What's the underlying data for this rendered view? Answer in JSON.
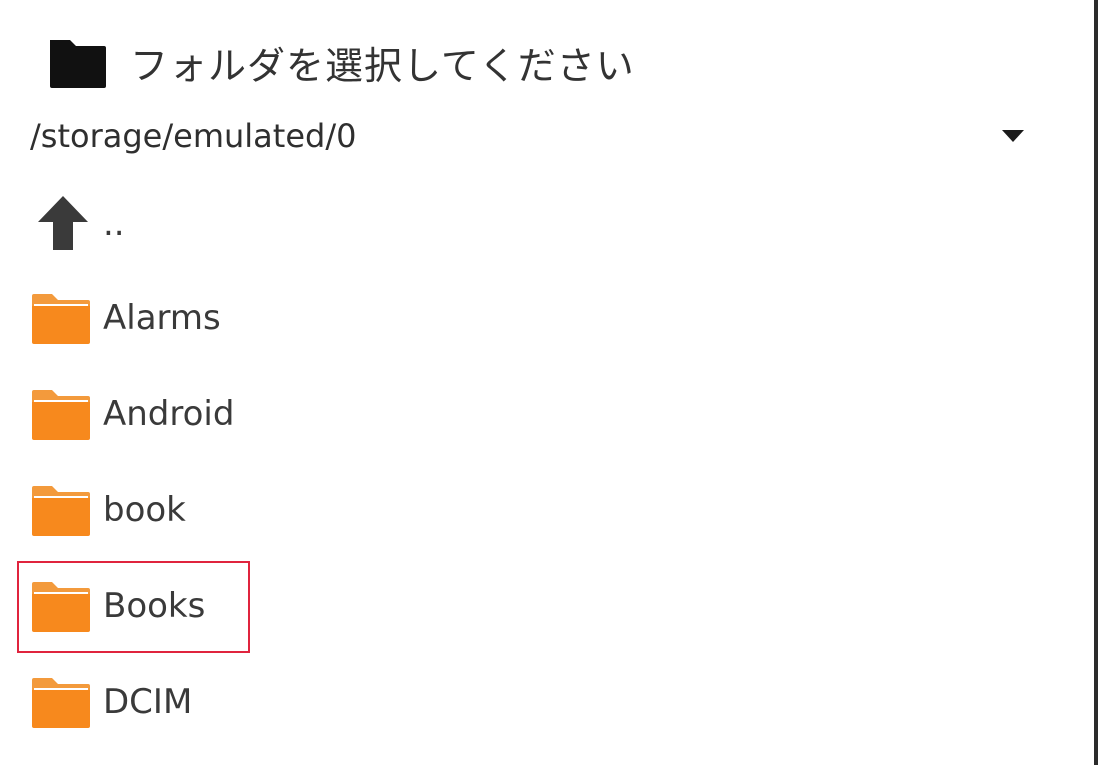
{
  "dialog": {
    "title": "フォルダを選択してください",
    "title_icon": "folder-icon"
  },
  "path_selector": {
    "value": "/storage/emulated/0",
    "icon": "chevron-down-icon"
  },
  "entries": [
    {
      "label": "..",
      "icon": "arrow-up-icon"
    },
    {
      "label": "Alarms",
      "icon": "folder-icon"
    },
    {
      "label": "Android",
      "icon": "folder-icon"
    },
    {
      "label": "book",
      "icon": "folder-icon"
    },
    {
      "label": "Books",
      "icon": "folder-icon",
      "highlighted": true
    },
    {
      "label": "DCIM",
      "icon": "folder-icon"
    }
  ],
  "colors": {
    "folder": "#f7891d",
    "folder_tab": "#f39a3c",
    "highlight_border": "#e0243e",
    "header_icon": "#111111"
  }
}
